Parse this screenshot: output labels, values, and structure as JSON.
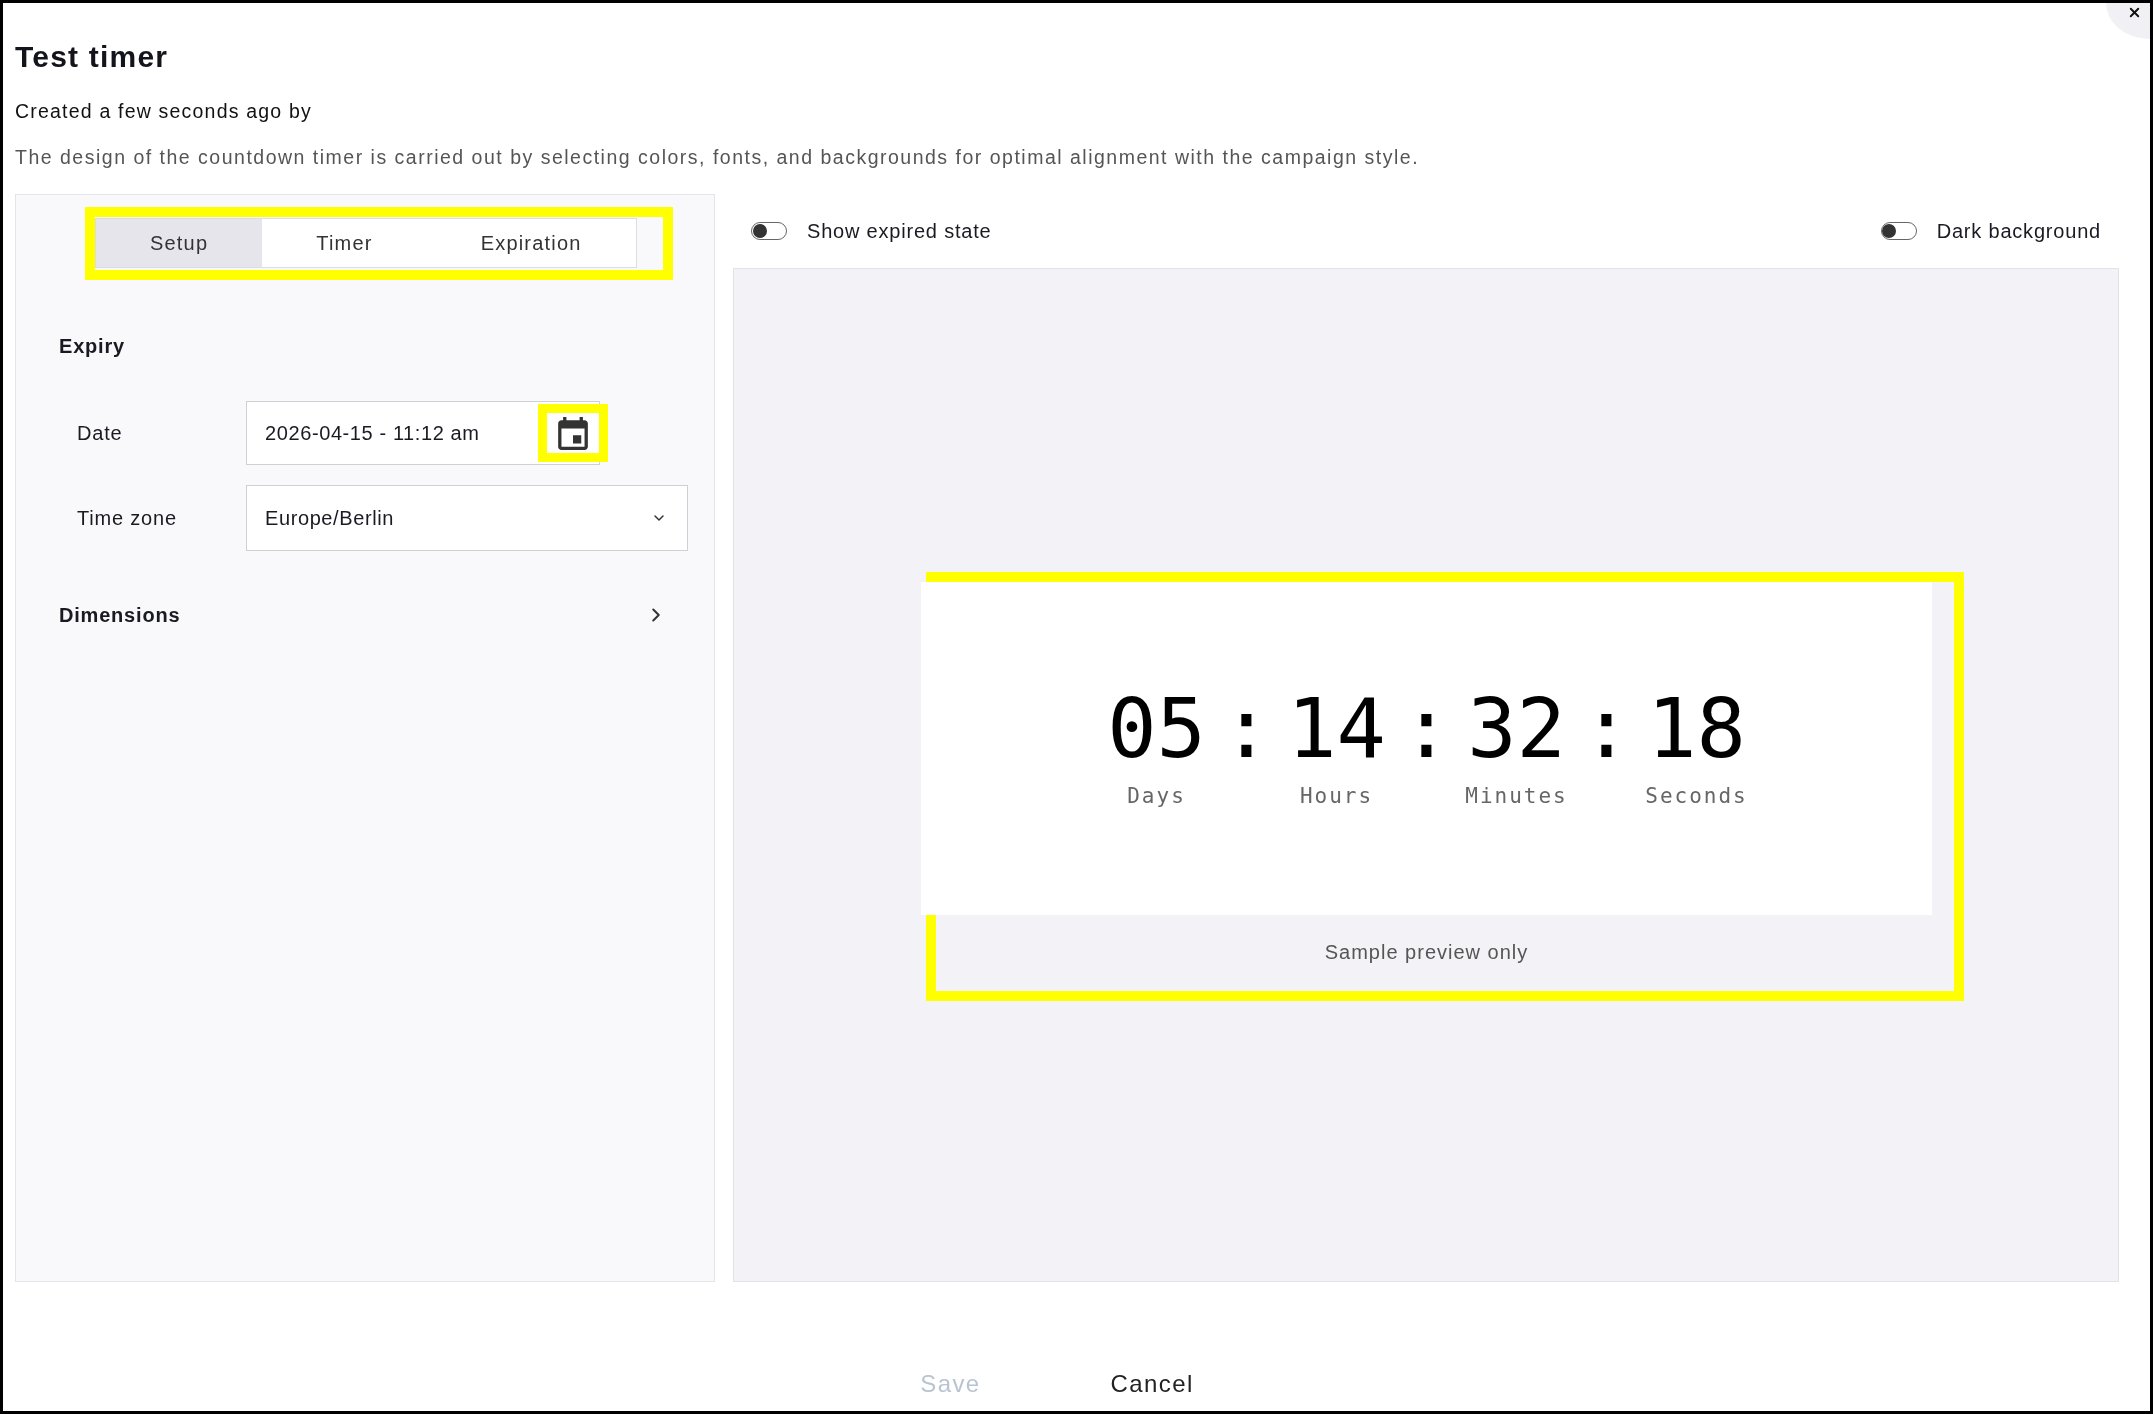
{
  "dialog": {
    "title": "Test timer",
    "subtitle": "Created a few seconds ago by",
    "description": "The design of the countdown timer is carried out by selecting colors, fonts, and backgrounds for optimal alignment with the campaign style."
  },
  "settings": {
    "tabs": {
      "highlighted": true,
      "items": [
        {
          "label": "Setup",
          "selected": true
        },
        {
          "label": "Timer",
          "selected": false
        },
        {
          "label": "Expiration",
          "selected": false
        }
      ]
    },
    "sections": [
      {
        "kind": "group",
        "title": "Expiry",
        "fields": [
          {
            "kind": "date",
            "label": "Date",
            "value": "2026-04-15 - 11:12 am",
            "picker_highlighted": true
          },
          {
            "kind": "select",
            "label": "Time zone",
            "value": "Europe/Berlin"
          }
        ]
      },
      {
        "kind": "collapsible",
        "title": "Dimensions",
        "expanded": false
      }
    ]
  },
  "preview": {
    "toggles": [
      {
        "label": "Show expired state",
        "on": false
      },
      {
        "label": "Dark background",
        "on": false
      }
    ],
    "highlighted": true,
    "timer": [
      {
        "kind": "unit",
        "value": "05",
        "label": "Days"
      },
      {
        "kind": "separator",
        "text": ":"
      },
      {
        "kind": "unit",
        "value": "14",
        "label": "Hours"
      },
      {
        "kind": "separator",
        "text": ":"
      },
      {
        "kind": "unit",
        "value": "32",
        "label": "Minutes"
      },
      {
        "kind": "separator",
        "text": ":"
      },
      {
        "kind": "unit",
        "value": "18",
        "label": "Seconds"
      }
    ],
    "caption": "Sample preview only"
  },
  "footer": {
    "buttons": [
      {
        "label": "Save",
        "disabled": true
      },
      {
        "label": "Cancel",
        "disabled": false
      }
    ]
  }
}
